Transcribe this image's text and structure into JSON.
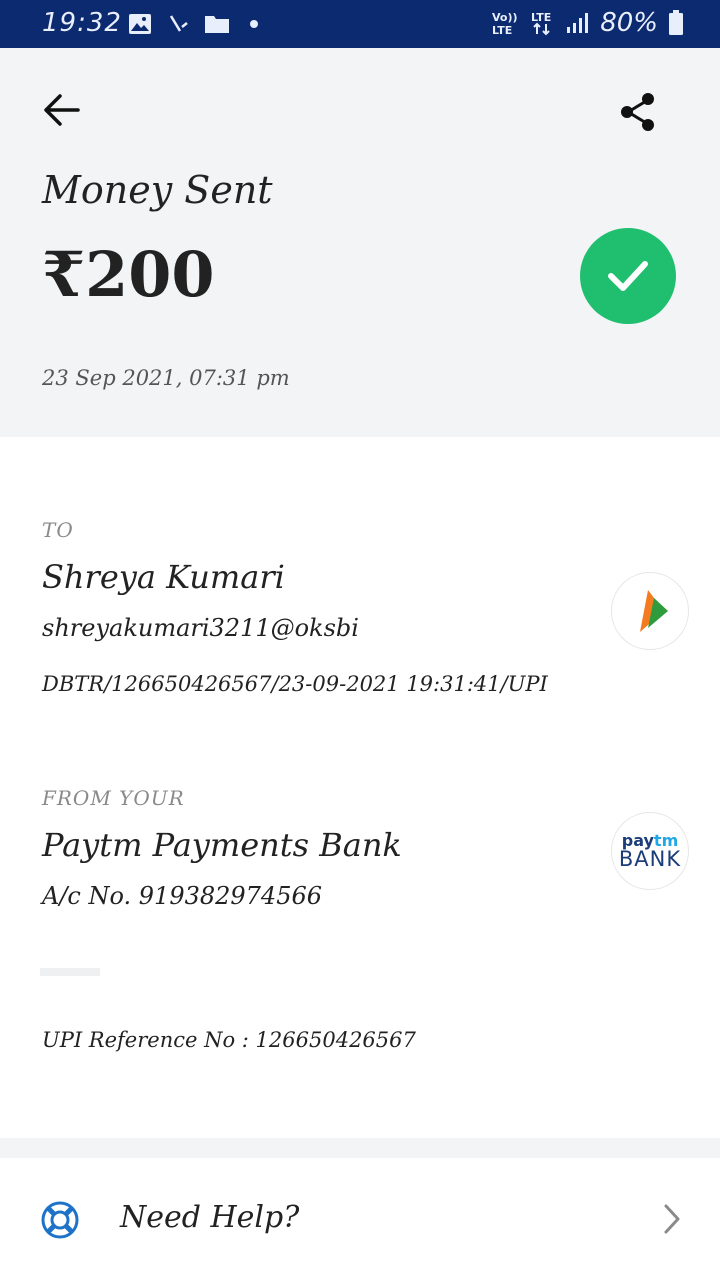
{
  "status_bar": {
    "time": "19:32",
    "network": "Vo)) LTE",
    "data": "LTE",
    "battery": "80%"
  },
  "header": {
    "title": "Money Sent",
    "amount": "₹200",
    "datetime": "23 Sep 2021, 07:31 pm",
    "success_color": "#1fbf6f"
  },
  "to": {
    "label": "TO",
    "name": "Shreya Kumari",
    "upi_id": "shreyakumari3211@oksbi",
    "reference": "DBTR/126650426567/23-09-2021 19:31:41/UPI",
    "bank_icon": "bhim-upi-icon"
  },
  "from": {
    "label": "FROM YOUR",
    "bank_name": "Paytm Payments Bank",
    "account": "A/c No. 919382974566",
    "logo_text_top_a": "pay",
    "logo_text_top_b": "tm",
    "logo_text_bottom": "BANK"
  },
  "upi_reference": "UPI Reference No : 126650426567",
  "help": {
    "label": "Need Help?",
    "icon": "lifebuoy-icon"
  }
}
